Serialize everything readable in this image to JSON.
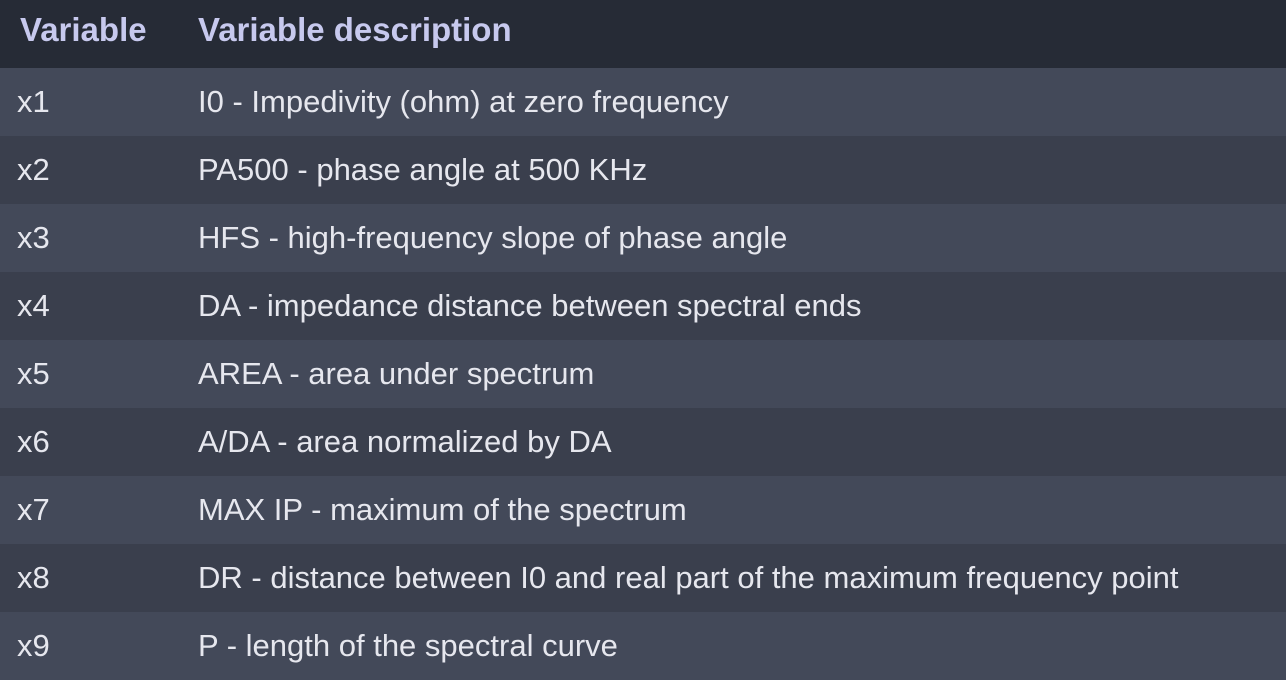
{
  "header": {
    "variable": "Variable",
    "description": "Variable description"
  },
  "rows": [
    {
      "variable": "x1",
      "description": "I0 - Impedivity (ohm) at zero frequency"
    },
    {
      "variable": "x2",
      "description": "PA500 - phase angle at 500 KHz"
    },
    {
      "variable": "x3",
      "description": "HFS - high-frequency slope of phase angle"
    },
    {
      "variable": "x4",
      "description": "DA - impedance distance between spectral ends"
    },
    {
      "variable": "x5",
      "description": "AREA - area under spectrum"
    },
    {
      "variable": "x6",
      "description": "A/DA - area normalized by DA"
    },
    {
      "variable": "x7",
      "description": "MAX IP - maximum of the spectrum"
    },
    {
      "variable": "x8",
      "description": "DR - distance between I0 and real part of the maximum frequency point"
    },
    {
      "variable": "x9",
      "description": "P - length of the spectral curve"
    }
  ]
}
